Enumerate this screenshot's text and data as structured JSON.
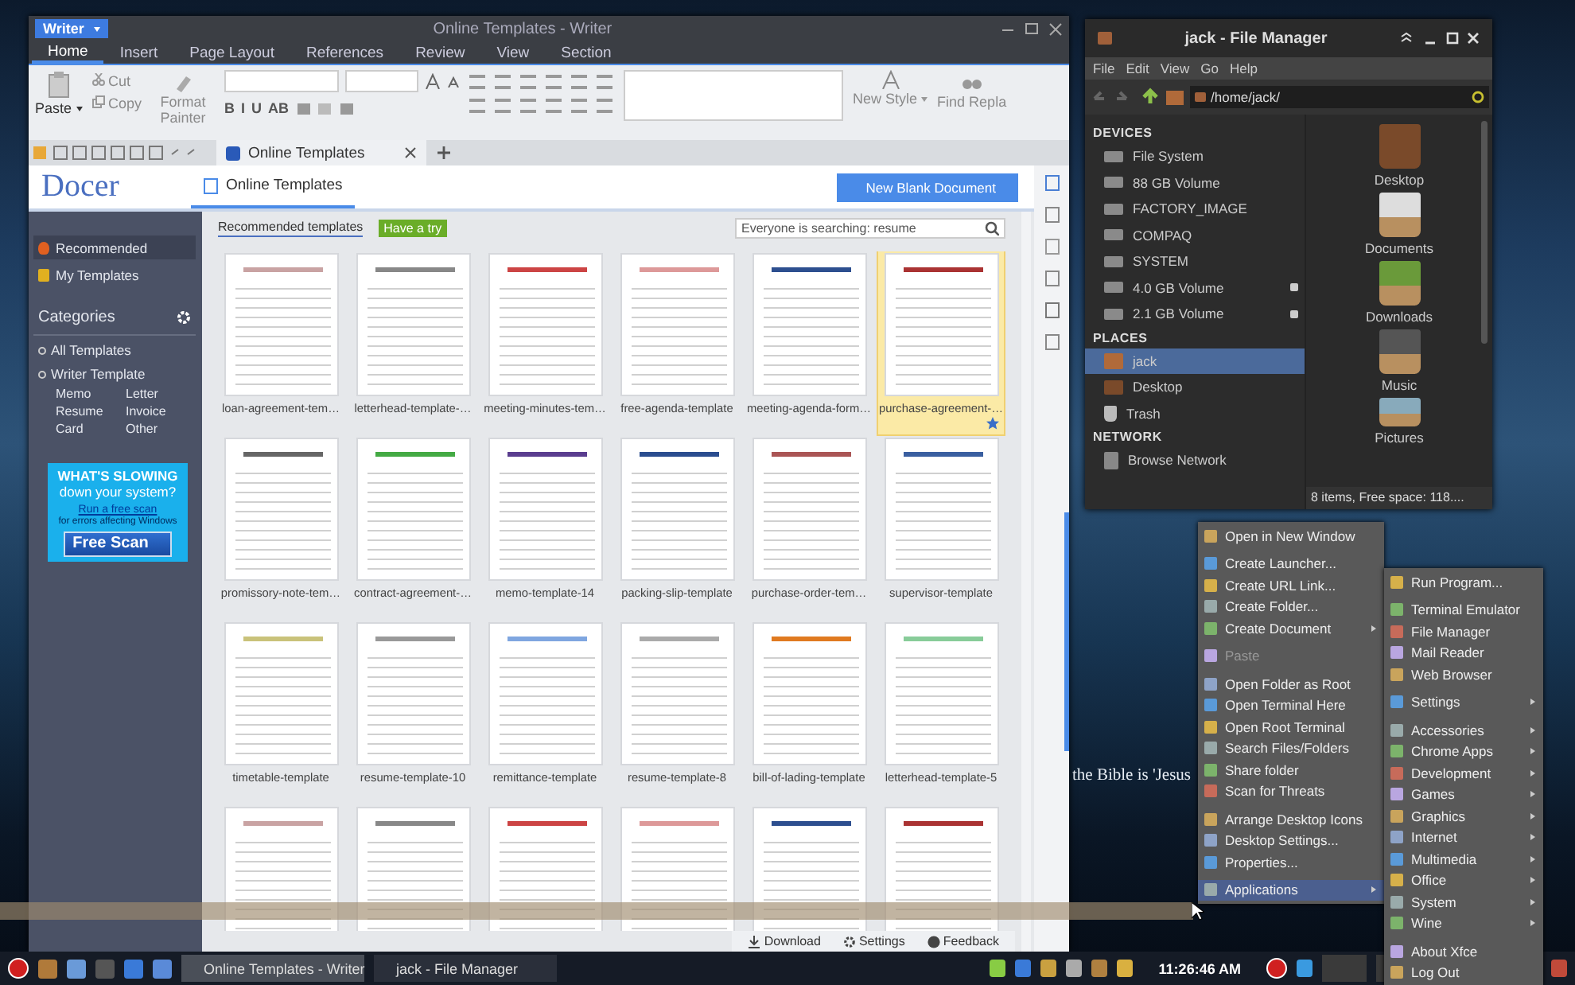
{
  "writer": {
    "app_button": "Writer",
    "title": "Online Templates - Writer",
    "menu_tabs": [
      {
        "label": "Home",
        "selected": true
      },
      {
        "label": "Insert",
        "selected": false
      },
      {
        "label": "Page Layout",
        "selected": false
      },
      {
        "label": "References",
        "selected": false
      },
      {
        "label": "Review",
        "selected": false
      },
      {
        "label": "View",
        "selected": false
      },
      {
        "label": "Section",
        "selected": false
      }
    ],
    "ribbon": {
      "paste": "Paste",
      "cut": "Cut",
      "copy": "Copy",
      "format_painter": "Format Painter",
      "format_buttons": [
        "B",
        "I",
        "U",
        "AB"
      ],
      "new_style": "New Style",
      "find_replace": "Find Repla"
    },
    "document_tab": "Online Templates",
    "docer": {
      "logo": "Docer",
      "page_tab": "Online Templates",
      "new_blank_button": "New Blank Document",
      "sidebar": {
        "items": [
          {
            "label": "Recommended",
            "selected": true
          },
          {
            "label": "My Templates",
            "selected": false
          }
        ],
        "categories_title": "Categories",
        "categories": [
          {
            "label": "All Templates"
          },
          {
            "label": "Writer Template",
            "children": [
              {
                "label": "Memo"
              },
              {
                "label": "Letter"
              },
              {
                "label": "Resume"
              },
              {
                "label": "Invoice"
              },
              {
                "label": "Card"
              },
              {
                "label": "Other"
              }
            ]
          }
        ]
      },
      "ad": {
        "headline": "WHAT'S SLOWING",
        "subhead": "down your system?",
        "link": "Run a free scan",
        "note": "for errors affecting Windows",
        "button": "Free Scan"
      },
      "subtab": "Recommended templates",
      "have_a_try": "Have a try",
      "search": {
        "placeholder": "Everyone is searching: resume"
      },
      "templates": [
        {
          "name": "loan-agreement-tem…",
          "selected": false
        },
        {
          "name": "letterhead-template-…",
          "selected": false
        },
        {
          "name": "meeting-minutes-tem…",
          "selected": false
        },
        {
          "name": "free-agenda-template",
          "selected": false
        },
        {
          "name": "meeting-agenda-form…",
          "selected": false
        },
        {
          "name": "purchase-agreement-…",
          "selected": true
        },
        {
          "name": "promissory-note-tem…",
          "selected": false
        },
        {
          "name": "contract-agreement-…",
          "selected": false
        },
        {
          "name": "memo-template-14",
          "selected": false
        },
        {
          "name": "packing-slip-template",
          "selected": false
        },
        {
          "name": "purchase-order-tem…",
          "selected": false
        },
        {
          "name": "supervisor-template",
          "selected": false
        },
        {
          "name": "timetable-template",
          "selected": false
        },
        {
          "name": "resume-template-10",
          "selected": false
        },
        {
          "name": "remittance-template",
          "selected": false
        },
        {
          "name": "resume-template-8",
          "selected": false
        },
        {
          "name": "bill-of-lading-template",
          "selected": false
        },
        {
          "name": "letterhead-template-5",
          "selected": false
        },
        {
          "selected": false
        },
        {
          "selected": false
        },
        {
          "selected": false
        },
        {
          "selected": false
        },
        {
          "selected": false
        },
        {
          "selected": false
        }
      ],
      "footer": [
        "Download",
        "Settings",
        "Feedback"
      ]
    }
  },
  "file_manager": {
    "title": "jack - File Manager",
    "menu": [
      "File",
      "Edit",
      "View",
      "Go",
      "Help"
    ],
    "path": "/home/jack/",
    "sections": [
      {
        "heading": "DEVICES",
        "items": [
          {
            "label": "File System",
            "kind": "drive",
            "ejectable": false,
            "selected": false
          },
          {
            "label": "88 GB Volume",
            "kind": "drive",
            "ejectable": false,
            "selected": false
          },
          {
            "label": "FACTORY_IMAGE",
            "kind": "drive",
            "ejectable": false,
            "selected": false
          },
          {
            "label": "COMPAQ",
            "kind": "drive",
            "ejectable": false,
            "selected": false
          },
          {
            "label": "SYSTEM",
            "kind": "drive",
            "ejectable": false,
            "selected": false
          },
          {
            "label": "4.0 GB Volume",
            "kind": "drive",
            "ejectable": true,
            "selected": false
          },
          {
            "label": "2.1 GB Volume",
            "kind": "drive",
            "ejectable": true,
            "selected": false
          }
        ]
      },
      {
        "heading": "PLACES",
        "items": [
          {
            "label": "jack",
            "kind": "home",
            "ejectable": false,
            "selected": true
          },
          {
            "label": "Desktop",
            "kind": "desk",
            "ejectable": false,
            "selected": false
          },
          {
            "label": "Trash",
            "kind": "trash",
            "ejectable": false,
            "selected": false
          }
        ]
      },
      {
        "heading": "NETWORK",
        "items": [
          {
            "label": "Browse Network",
            "kind": "network",
            "ejectable": false,
            "selected": false
          }
        ]
      }
    ],
    "files": [
      {
        "name": "Desktop",
        "kind": "desk"
      },
      {
        "name": "Documents",
        "kind": "documents"
      },
      {
        "name": "Downloads",
        "kind": "downloads"
      },
      {
        "name": "Music",
        "kind": "music"
      },
      {
        "name": "Pictures",
        "kind": "pictures"
      }
    ],
    "status": "8 items, Free space: 118...."
  },
  "desktop_text": "the Bible is 'Jesus",
  "context_menu": {
    "items": [
      {
        "kind": "item",
        "label": "Open in New Window",
        "disabled": false,
        "submenu": false,
        "selected": false
      },
      {
        "kind": "separator"
      },
      {
        "kind": "item",
        "label": "Create Launcher...",
        "disabled": false,
        "submenu": false,
        "selected": false
      },
      {
        "kind": "item",
        "label": "Create URL Link...",
        "disabled": false,
        "submenu": false,
        "selected": false
      },
      {
        "kind": "item",
        "label": "Create Folder...",
        "disabled": false,
        "submenu": false,
        "selected": false
      },
      {
        "kind": "item",
        "label": "Create Document",
        "disabled": false,
        "submenu": true,
        "selected": false
      },
      {
        "kind": "separator"
      },
      {
        "kind": "item",
        "label": "Paste",
        "disabled": true,
        "submenu": false,
        "selected": false
      },
      {
        "kind": "separator"
      },
      {
        "kind": "item",
        "label": "Open Folder as Root",
        "disabled": false,
        "submenu": false,
        "selected": false
      },
      {
        "kind": "item",
        "label": "Open Terminal Here",
        "disabled": false,
        "submenu": false,
        "selected": false
      },
      {
        "kind": "item",
        "label": "Open Root Terminal",
        "disabled": false,
        "submenu": false,
        "selected": false
      },
      {
        "kind": "item",
        "label": "Search Files/Folders",
        "disabled": false,
        "submenu": false,
        "selected": false
      },
      {
        "kind": "item",
        "label": "Share folder",
        "disabled": false,
        "submenu": false,
        "selected": false
      },
      {
        "kind": "item",
        "label": "Scan for Threats",
        "disabled": false,
        "submenu": false,
        "selected": false
      },
      {
        "kind": "separator"
      },
      {
        "kind": "item",
        "label": "Arrange Desktop Icons",
        "disabled": false,
        "submenu": false,
        "selected": false
      },
      {
        "kind": "item",
        "label": "Desktop Settings...",
        "disabled": false,
        "submenu": false,
        "selected": false
      },
      {
        "kind": "item",
        "label": "Properties...",
        "disabled": false,
        "submenu": false,
        "selected": false
      },
      {
        "kind": "separator"
      },
      {
        "kind": "item",
        "label": "Applications",
        "disabled": false,
        "submenu": true,
        "selected": true
      }
    ]
  },
  "applications_menu": {
    "items": [
      {
        "kind": "item",
        "label": "Run Program...",
        "submenu": false
      },
      {
        "kind": "separator"
      },
      {
        "kind": "item",
        "label": "Terminal Emulator",
        "submenu": false
      },
      {
        "kind": "item",
        "label": "File Manager",
        "submenu": false
      },
      {
        "kind": "item",
        "label": "Mail Reader",
        "submenu": false
      },
      {
        "kind": "item",
        "label": "Web Browser",
        "submenu": false
      },
      {
        "kind": "separator"
      },
      {
        "kind": "item",
        "label": "Settings",
        "submenu": true
      },
      {
        "kind": "separator"
      },
      {
        "kind": "item",
        "label": "Accessories",
        "submenu": true
      },
      {
        "kind": "item",
        "label": "Chrome Apps",
        "submenu": true
      },
      {
        "kind": "item",
        "label": "Development",
        "submenu": true
      },
      {
        "kind": "item",
        "label": "Games",
        "submenu": true
      },
      {
        "kind": "item",
        "label": "Graphics",
        "submenu": true
      },
      {
        "kind": "item",
        "label": "Internet",
        "submenu": true
      },
      {
        "kind": "item",
        "label": "Multimedia",
        "submenu": true
      },
      {
        "kind": "item",
        "label": "Office",
        "submenu": true
      },
      {
        "kind": "item",
        "label": "System",
        "submenu": true
      },
      {
        "kind": "item",
        "label": "Wine",
        "submenu": true
      },
      {
        "kind": "separator"
      },
      {
        "kind": "item",
        "label": "About Xfce",
        "submenu": false
      },
      {
        "kind": "item",
        "label": "Log Out",
        "submenu": false
      }
    ]
  },
  "taskbar": {
    "windows": [
      {
        "label": "Online Templates - Writer",
        "selected": true
      },
      {
        "label": "jack - File Manager",
        "selected": false
      }
    ],
    "clock": "11:26:46 AM"
  }
}
